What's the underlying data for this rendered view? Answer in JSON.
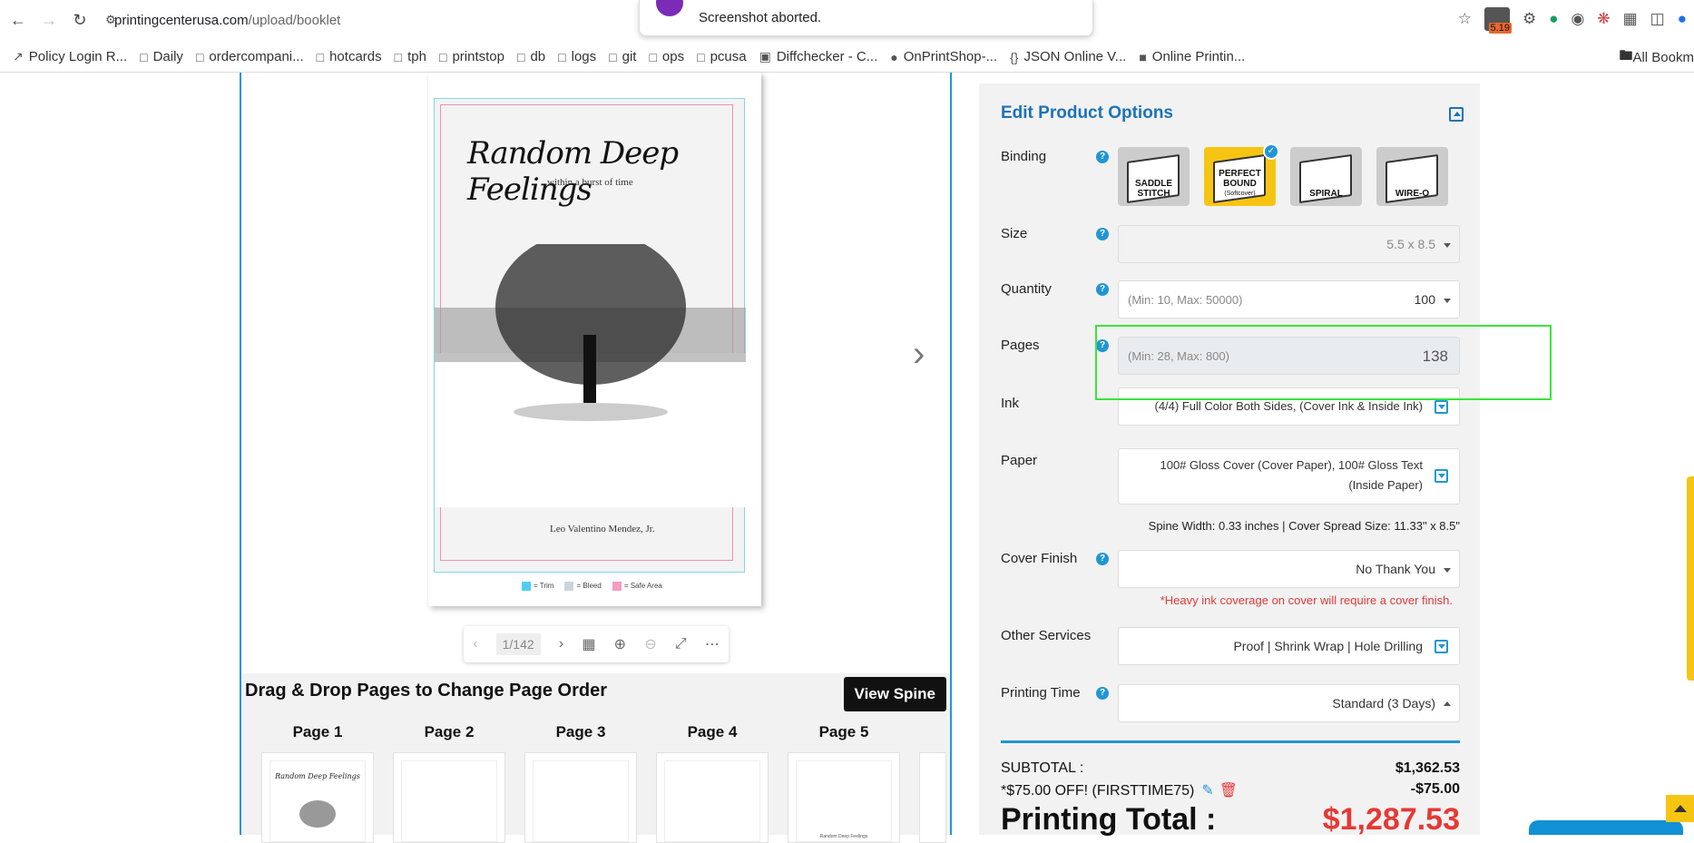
{
  "browser": {
    "url_host": "printingcenterusa.com",
    "url_path": "/upload/booklet",
    "ext_badge": "5.19",
    "toast_text": "Screenshot aborted."
  },
  "bookmarks": [
    {
      "label": "Policy Login R...",
      "icon": "link-icon"
    },
    {
      "label": "Daily",
      "icon": "folder-icon"
    },
    {
      "label": "ordercompani...",
      "icon": "folder-icon"
    },
    {
      "label": "hotcards",
      "icon": "folder-icon"
    },
    {
      "label": "tph",
      "icon": "folder-icon"
    },
    {
      "label": "printstop",
      "icon": "folder-icon"
    },
    {
      "label": "db",
      "icon": "folder-icon"
    },
    {
      "label": "logs",
      "icon": "folder-icon"
    },
    {
      "label": "git",
      "icon": "folder-icon"
    },
    {
      "label": "ops",
      "icon": "folder-icon"
    },
    {
      "label": "pcusa",
      "icon": "folder-icon"
    },
    {
      "label": "Diffchecker - C...",
      "icon": "diffchecker-icon"
    },
    {
      "label": "OnPrintShop-...",
      "icon": "onprintshop-icon"
    },
    {
      "label": "JSON Online V...",
      "icon": "json-icon"
    },
    {
      "label": "Online Printin...",
      "icon": "printing-icon"
    }
  ],
  "bookmarks_all": "All Bookm",
  "preview": {
    "cover_title": "Random Deep Feelings",
    "cover_subtitle": "within a burst of time",
    "cover_author": "Leo Valentino Mendez, Jr.",
    "legend": [
      "= Trim",
      "= Bleed",
      "= Safe Area"
    ],
    "legend_colors": [
      "#4dd0f0",
      "#c8d6dc",
      "#f59cc0"
    ],
    "page_indicator": "1/142"
  },
  "pages_section": {
    "title": "Drag & Drop Pages to Change Page Order",
    "view_spine": "View Spine",
    "pages": [
      "Page 1",
      "Page 2",
      "Page 3",
      "Page 4",
      "Page 5"
    ],
    "page5_thumb_text": "Random Deep Feelings"
  },
  "options": {
    "title": "Edit Product Options",
    "binding_label": "Binding",
    "binding_options": [
      {
        "label": "SADDLE STITCH",
        "sub": "",
        "selected": false
      },
      {
        "label": "PERFECT BOUND",
        "sub": "(Softcover)",
        "selected": true
      },
      {
        "label": "SPIRAL",
        "sub": "",
        "selected": false
      },
      {
        "label": "WIRE-O",
        "sub": "",
        "selected": false
      }
    ],
    "size_label": "Size",
    "size_value": "5.5 x 8.5",
    "quantity_label": "Quantity",
    "quantity_hint": "(Min: 10, Max: 50000)",
    "quantity_value": "100",
    "pages_label": "Pages",
    "pages_hint": "(Min: 28, Max: 800)",
    "pages_value": "138",
    "ink_label": "Ink",
    "ink_value": "(4/4) Full Color Both Sides, (Cover Ink & Inside Ink)",
    "paper_label": "Paper",
    "paper_value_1": "100# Gloss Cover (Cover Paper), 100# Gloss Text",
    "paper_value_2": "(Inside Paper)",
    "spine_info": "Spine Width: 0.33 inches | Cover Spread Size: 11.33\" x 8.5\"",
    "cover_finish_label": "Cover Finish",
    "cover_finish_value": "No Thank You",
    "cover_finish_warning": "*Heavy ink coverage on cover will require a cover finish.",
    "other_label": "Other Services",
    "other_value": "Proof | Shrink Wrap | Hole Drilling",
    "printing_time_label": "Printing Time",
    "printing_time_value": "Standard (3 Days)"
  },
  "totals": {
    "subtotal_label": "SUBTOTAL :",
    "subtotal_value": "$1,362.53",
    "discount_label": "*$75.00 OFF! (FIRSTTIME75)",
    "discount_value": "-$75.00",
    "total_label": "Printing Total :",
    "total_value": "$1,287.53"
  },
  "colors": {
    "accent": "#2196d3",
    "highlight": "#f6c513",
    "price": "#e53935",
    "title": "#1a73b8"
  }
}
